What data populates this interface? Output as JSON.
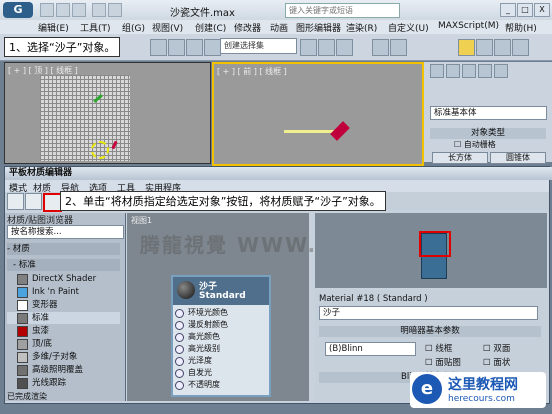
{
  "app": {
    "logo": "G",
    "title": "沙瓷文件.max",
    "search_placeholder": "键入关键字或短语",
    "window_buttons": [
      "_",
      "□",
      "X"
    ]
  },
  "menubar": [
    "编辑(E)",
    "工具(T)",
    "组(G)",
    "视图(V)",
    "创建(C)",
    "修改器",
    "动画",
    "图形编辑器",
    "渲染(R)",
    "自定义(U)",
    "MAXScript(M)",
    "帮助(H)"
  ],
  "toolbar": {
    "selection_set": "创建选择集"
  },
  "viewports": {
    "left_label": "[ + ] [ 顶 ] [ 线框 ]",
    "right_label": "[ + ] [ 前 ] [ 线框 ]"
  },
  "command_panel": {
    "category": "标准基本体",
    "rollout_title": "对象类型",
    "auto_grid": "自动栅格",
    "buttons": [
      "长方体",
      "圆锥体"
    ]
  },
  "callouts": {
    "step1": "1、选择“沙子”对象。",
    "step2": "2、单击“将材质指定给选定对象”按钮，将材质赋予“沙子”对象。"
  },
  "material_editor": {
    "title": "平板材质编辑器",
    "menus": [
      "模式",
      "材质",
      "导航",
      "选项",
      "工具",
      "实用程序"
    ],
    "browser": {
      "header": "材质/贴图浏览器",
      "search": "按名称搜索...",
      "group_materials": "- 材质",
      "group_standard": "- 标准",
      "items": [
        {
          "label": "DirectX Shader",
          "color": "#808080"
        },
        {
          "label": "Ink 'n Paint",
          "color": "#4aa3df"
        },
        {
          "label": "变形器",
          "color": "#ffffff"
        },
        {
          "label": "标准",
          "color": "#7a7a7a"
        },
        {
          "label": "虫漆",
          "color": "#b30000"
        },
        {
          "label": "顶/底",
          "color": "#a0a0a0"
        },
        {
          "label": "多维/子对象",
          "color": "#c0c0c0"
        },
        {
          "label": "高级照明覆盖",
          "color": "#707070"
        },
        {
          "label": "光线跟踪",
          "color": "#505050"
        }
      ]
    },
    "view_tab": "视图1",
    "watermark": "腾龍視覺 WWW.TENGI.NET",
    "node": {
      "name": "沙子",
      "type": "Standard",
      "slots": [
        "环境光颜色",
        "漫反射颜色",
        "高光颜色",
        "高光级别",
        "光泽度",
        "自发光",
        "不透明度"
      ]
    },
    "params": {
      "material_label": "Material #18  ( Standard )",
      "name_value": "沙子",
      "shader_rollout": "明暗器基本参数",
      "shader": "(B)Blinn",
      "wire": "线框",
      "two_sided": "双面",
      "face_map": "面贴图",
      "faceted": "面状",
      "blinn_rollout": "Blinn 基本参数"
    },
    "status": "已完成渲染"
  },
  "site_logo": {
    "name": "这里教程网",
    "url": "herecours.com"
  }
}
